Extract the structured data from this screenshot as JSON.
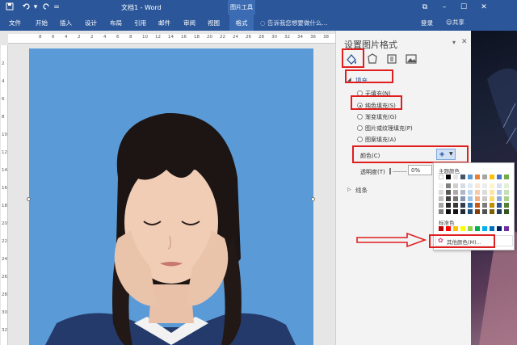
{
  "title_bar": {
    "document_title": "文档1 - Word",
    "contextual_group": "图片工具",
    "quick_access": [
      "save-icon",
      "undo-icon",
      "redo-icon",
      "customize-icon"
    ],
    "window_buttons": [
      "restore-icon",
      "minimize-icon",
      "maximize-icon",
      "close-icon"
    ]
  },
  "ribbon": {
    "tabs": [
      "文件",
      "开始",
      "插入",
      "设计",
      "布局",
      "引用",
      "邮件",
      "审阅",
      "视图",
      "格式"
    ],
    "active_tab": "格式",
    "tell_me": "告诉我您想要做什么...",
    "sign_in": "登录",
    "share": "共享"
  },
  "ruler": {
    "horizontal_ticks": [
      "8",
      "6",
      "4",
      "2",
      "2",
      "4",
      "6",
      "8",
      "10",
      "12",
      "14",
      "16",
      "18",
      "20",
      "22",
      "24",
      "26",
      "28",
      "30",
      "32",
      "34",
      "36",
      "38"
    ],
    "vertical_ticks": [
      "2",
      "4",
      "6",
      "8",
      "10",
      "12",
      "14",
      "16",
      "18",
      "20",
      "22",
      "24",
      "26",
      "28",
      "30",
      "32"
    ]
  },
  "format_pane": {
    "title": "设置图片格式",
    "tab_icons": [
      "fill-line-icon",
      "effects-icon",
      "layout-properties-icon",
      "picture-icon"
    ],
    "fill_section": "填充",
    "fill_options": [
      {
        "label": "无填充(N)",
        "selected": false
      },
      {
        "label": "纯色填充(S)",
        "selected": true
      },
      {
        "label": "渐变填充(G)",
        "selected": false
      },
      {
        "label": "图片或纹理填充(P)",
        "selected": false
      },
      {
        "label": "图案填充(A)",
        "selected": false
      }
    ],
    "color_label": "颜色(C)",
    "transparency_label": "透明度(T)",
    "transparency_value": "0%",
    "line_section": "线条"
  },
  "color_dropdown": {
    "theme_colors_label": "主题颜色",
    "standard_colors_label": "标准色",
    "more_colors": "其他颜色(M)...",
    "theme_top_row": [
      "#ffffff",
      "#000000",
      "#e7e6e6",
      "#44546a",
      "#5b9bd5",
      "#ed7d31",
      "#a5a5a5",
      "#ffc000",
      "#4472c4",
      "#70ad47"
    ],
    "theme_shade_columns": [
      [
        "#f2f2f2",
        "#d9d9d9",
        "#bfbfbf",
        "#a6a6a6",
        "#808080"
      ],
      [
        "#808080",
        "#595959",
        "#404040",
        "#262626",
        "#0d0d0d"
      ],
      [
        "#d0cece",
        "#aeaaaa",
        "#757171",
        "#3a3838",
        "#171616"
      ],
      [
        "#d6dce4",
        "#adb9ca",
        "#8496b0",
        "#333f4f",
        "#222a35"
      ],
      [
        "#deebf6",
        "#bdd7ee",
        "#9dc3e6",
        "#2e75b5",
        "#1f4e79"
      ],
      [
        "#fbe5d5",
        "#f7cbac",
        "#f4b183",
        "#c55a11",
        "#833c0b"
      ],
      [
        "#ededed",
        "#dbdbdb",
        "#c9c9c9",
        "#7b7b7b",
        "#525252"
      ],
      [
        "#fff2cc",
        "#ffe599",
        "#ffd966",
        "#bf9000",
        "#7f6000"
      ],
      [
        "#d9e2f3",
        "#b4c6e7",
        "#8eaadb",
        "#2f5496",
        "#1f3864"
      ],
      [
        "#e2efd9",
        "#c5e0b3",
        "#a8d08d",
        "#538135",
        "#375623"
      ]
    ],
    "standard": [
      "#c00000",
      "#ff0000",
      "#ffc000",
      "#ffff00",
      "#92d050",
      "#00b050",
      "#00b0f0",
      "#0070c0",
      "#002060",
      "#7030a0"
    ]
  },
  "colors": {
    "word_blue": "#2b579a",
    "picture_background": "#5a9bd7",
    "annotation_red": "#e01e1e"
  }
}
